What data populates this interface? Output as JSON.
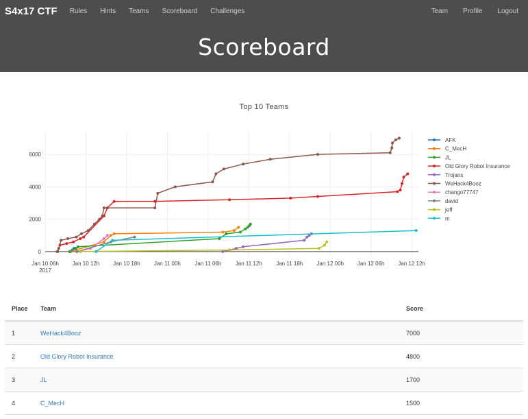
{
  "nav": {
    "brand": "S4x17 CTF",
    "left": [
      "Rules",
      "Hints",
      "Teams",
      "Scoreboard",
      "Challenges"
    ],
    "right": [
      "Team",
      "Profile",
      "Logout"
    ]
  },
  "page": {
    "title": "Scoreboard"
  },
  "chart_data": {
    "type": "line",
    "title": "Top 10 Teams",
    "xlabel": "",
    "ylabel": "",
    "x_is_datetime": true,
    "x_range": [
      "2017-01-10 06:00",
      "2017-01-12 13:00"
    ],
    "ylim": [
      -300,
      7400
    ],
    "x_ticks": [
      {
        "t": "2017-01-10 06:00",
        "label": "Jan 10 06h",
        "sub": "2017"
      },
      {
        "t": "2017-01-10 12:00",
        "label": "Jan 10 12h"
      },
      {
        "t": "2017-01-10 18:00",
        "label": "Jan 10 18h"
      },
      {
        "t": "2017-01-11 00:00",
        "label": "Jan 11 00h"
      },
      {
        "t": "2017-01-11 06:00",
        "label": "Jan 11 06h"
      },
      {
        "t": "2017-01-11 12:00",
        "label": "Jan 11 12h"
      },
      {
        "t": "2017-01-11 18:00",
        "label": "Jan 11 18h"
      },
      {
        "t": "2017-01-12 00:00",
        "label": "Jan 12 00h"
      },
      {
        "t": "2017-01-12 06:00",
        "label": "Jan 12 06h"
      },
      {
        "t": "2017-01-12 12:00",
        "label": "Jan 12 12h"
      }
    ],
    "y_ticks": [
      0,
      2000,
      4000,
      6000
    ],
    "grid": true,
    "legend": "right",
    "series": [
      {
        "name": "AFK",
        "color": "#1f77b4",
        "points": [
          [
            "2017-01-10 09:45",
            0
          ],
          [
            "2017-01-10 10:00",
            100
          ],
          [
            "2017-01-10 10:15",
            200
          ],
          [
            "2017-01-10 10:30",
            200
          ]
        ]
      },
      {
        "name": "C_MecH",
        "color": "#ff7f0e",
        "points": [
          [
            "2017-01-10 09:40",
            0
          ],
          [
            "2017-01-10 14:40",
            600
          ],
          [
            "2017-01-10 15:40",
            1000
          ],
          [
            "2017-01-10 16:10",
            1100
          ],
          [
            "2017-01-11 08:10",
            1200
          ],
          [
            "2017-01-11 09:50",
            1300
          ],
          [
            "2017-01-11 10:30",
            1500
          ]
        ]
      },
      {
        "name": "JL",
        "color": "#2ca02c",
        "points": [
          [
            "2017-01-10 09:35",
            0
          ],
          [
            "2017-01-10 10:50",
            300
          ],
          [
            "2017-01-11 07:40",
            800
          ],
          [
            "2017-01-11 08:40",
            1100
          ],
          [
            "2017-01-11 10:45",
            1200
          ],
          [
            "2017-01-11 11:30",
            1400
          ],
          [
            "2017-01-11 11:50",
            1500
          ],
          [
            "2017-01-11 12:05",
            1600
          ],
          [
            "2017-01-11 12:15",
            1700
          ]
        ]
      },
      {
        "name": "Old Glory Robot Insurance",
        "color": "#d62728",
        "points": [
          [
            "2017-01-10 07:50",
            0
          ],
          [
            "2017-01-10 08:10",
            400
          ],
          [
            "2017-01-10 09:10",
            500
          ],
          [
            "2017-01-10 10:10",
            600
          ],
          [
            "2017-01-10 11:10",
            800
          ],
          [
            "2017-01-10 11:40",
            900
          ],
          [
            "2017-01-10 14:40",
            2200
          ],
          [
            "2017-01-10 15:10",
            2700
          ],
          [
            "2017-01-10 16:10",
            3100
          ],
          [
            "2017-01-10 22:10",
            3100
          ],
          [
            "2017-01-11 09:10",
            3200
          ],
          [
            "2017-01-11 18:10",
            3300
          ],
          [
            "2017-01-11 22:10",
            3400
          ],
          [
            "2017-01-12 09:55",
            3700
          ],
          [
            "2017-01-12 10:20",
            3800
          ],
          [
            "2017-01-12 10:35",
            4200
          ],
          [
            "2017-01-12 10:50",
            4600
          ],
          [
            "2017-01-12 11:25",
            4800
          ]
        ]
      },
      {
        "name": "Trojans",
        "color": "#9467bd",
        "points": [
          [
            "2017-01-11 08:10",
            0
          ],
          [
            "2017-01-11 10:10",
            200
          ],
          [
            "2017-01-11 11:10",
            300
          ],
          [
            "2017-01-11 20:10",
            700
          ],
          [
            "2017-01-11 20:35",
            900
          ],
          [
            "2017-01-11 20:55",
            1000
          ],
          [
            "2017-01-11 21:15",
            1100
          ]
        ]
      },
      {
        "name": "WeHack4Booz",
        "color": "#8c564b",
        "points": [
          [
            "2017-01-10 07:45",
            0
          ],
          [
            "2017-01-10 08:00",
            200
          ],
          [
            "2017-01-10 08:20",
            700
          ],
          [
            "2017-01-10 09:20",
            800
          ],
          [
            "2017-01-10 10:35",
            900
          ],
          [
            "2017-01-10 11:20",
            1100
          ],
          [
            "2017-01-10 12:20",
            1300
          ],
          [
            "2017-01-10 13:15",
            1700
          ],
          [
            "2017-01-10 14:00",
            2000
          ],
          [
            "2017-01-10 14:25",
            2200
          ],
          [
            "2017-01-10 14:40",
            2700
          ],
          [
            "2017-01-10 22:10",
            2700
          ],
          [
            "2017-01-10 22:35",
            3600
          ],
          [
            "2017-01-11 01:10",
            4000
          ],
          [
            "2017-01-11 06:40",
            4300
          ],
          [
            "2017-01-11 07:10",
            4800
          ],
          [
            "2017-01-11 08:20",
            5100
          ],
          [
            "2017-01-11 11:10",
            5400
          ],
          [
            "2017-01-11 15:10",
            5700
          ],
          [
            "2017-01-11 22:10",
            6000
          ],
          [
            "2017-01-12 08:50",
            6100
          ],
          [
            "2017-01-12 09:05",
            6400
          ],
          [
            "2017-01-12 09:10",
            6700
          ],
          [
            "2017-01-12 09:40",
            6900
          ],
          [
            "2017-01-12 10:10",
            7000
          ]
        ]
      },
      {
        "name": "chango77747",
        "color": "#e377c2",
        "points": [
          [
            "2017-01-10 10:40",
            0
          ],
          [
            "2017-01-10 12:40",
            200
          ],
          [
            "2017-01-10 14:40",
            800
          ],
          [
            "2017-01-10 15:10",
            1000
          ]
        ]
      },
      {
        "name": "david",
        "color": "#7f7f7f",
        "points": [
          [
            "2017-01-10 10:40",
            0
          ],
          [
            "2017-01-10 15:40",
            600
          ],
          [
            "2017-01-10 19:10",
            900
          ]
        ]
      },
      {
        "name": "jeff",
        "color": "#bcbd22",
        "points": [
          [
            "2017-01-10 11:10",
            0
          ],
          [
            "2017-01-11 09:10",
            100
          ],
          [
            "2017-01-11 22:20",
            200
          ],
          [
            "2017-01-11 23:10",
            400
          ],
          [
            "2017-01-11 23:30",
            600
          ]
        ]
      },
      {
        "name": "m",
        "color": "#17becf",
        "points": [
          [
            "2017-01-10 13:30",
            0
          ],
          [
            "2017-01-10 15:55",
            700
          ],
          [
            "2017-01-12 12:40",
            1300
          ]
        ]
      }
    ]
  },
  "table": {
    "headers": [
      "Place",
      "Team",
      "Score"
    ],
    "rows": [
      {
        "place": "1",
        "team": "WeHack4Booz",
        "score": "7000"
      },
      {
        "place": "2",
        "team": "Old Glory Robot Insurance",
        "score": "4800"
      },
      {
        "place": "3",
        "team": "JL",
        "score": "1700"
      },
      {
        "place": "4",
        "team": "C_MecH",
        "score": "1500"
      }
    ]
  }
}
